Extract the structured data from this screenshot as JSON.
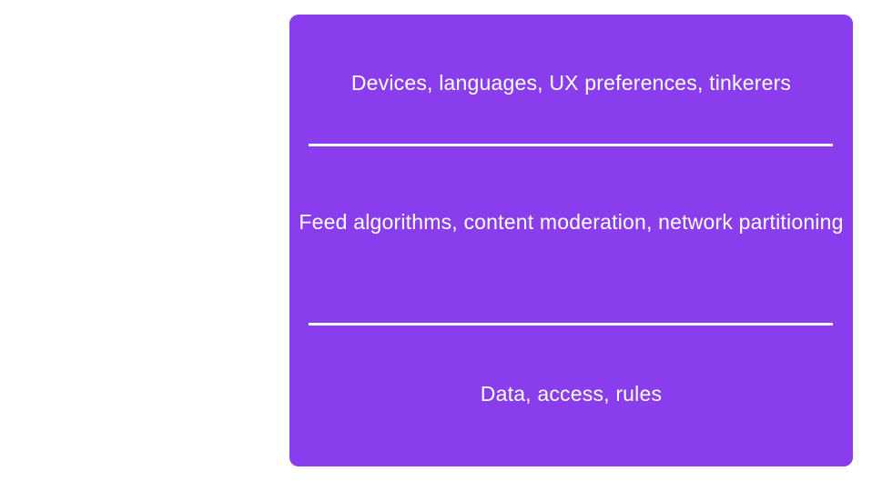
{
  "layers": [
    {
      "label": "Devices, languages, UX preferences, tinkerers"
    },
    {
      "label": "Feed algorithms, content moderation, network partitioning"
    },
    {
      "label": "Data, access, rules"
    }
  ],
  "colors": {
    "panel": "#8a3ded",
    "text": "#ffffff",
    "divider": "#ffffff",
    "background": "#ffffff"
  }
}
